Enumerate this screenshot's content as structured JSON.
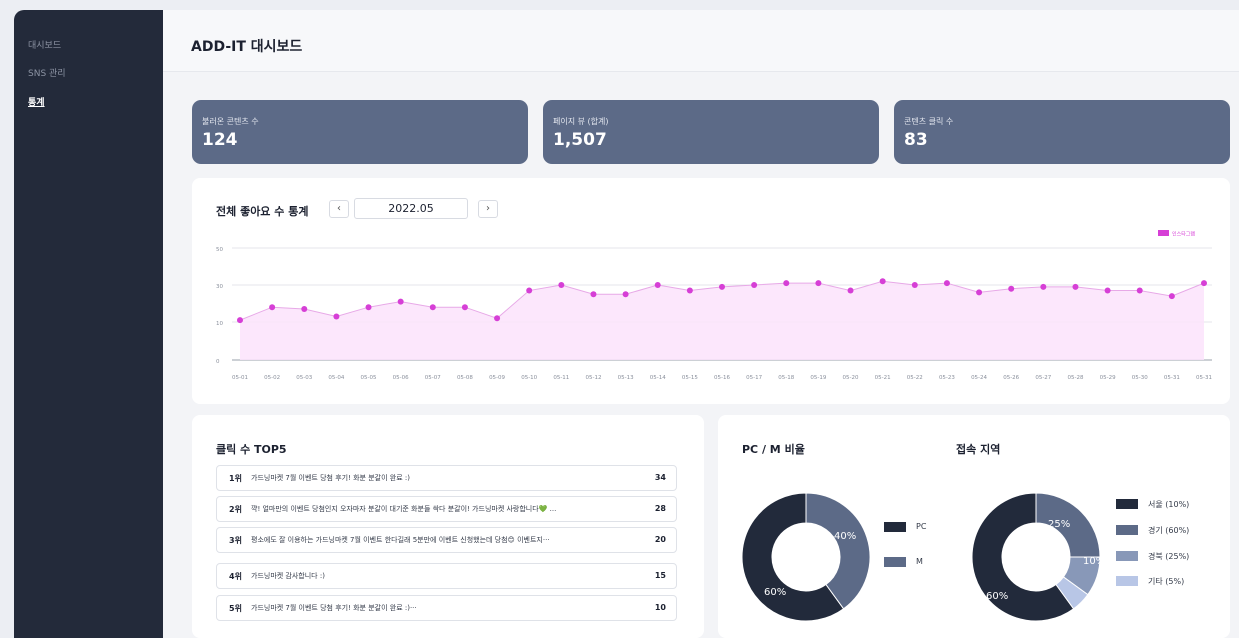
{
  "sidebar": {
    "items": [
      {
        "label": "대시보드",
        "active": false
      },
      {
        "label": "SNS 관리",
        "active": false
      },
      {
        "label": "통계",
        "active": true
      }
    ]
  },
  "header": {
    "title": "ADD-IT 대시보드"
  },
  "stats": [
    {
      "label": "불러온 콘텐츠 수",
      "value": "124"
    },
    {
      "label": "페이지 뷰 (합계)",
      "value": "1,507"
    },
    {
      "label": "콘텐츠 클릭 수",
      "value": "83"
    }
  ],
  "likes_chart": {
    "title": "전체 좋아요 수 통계",
    "prev_label": "‹",
    "next_label": "›",
    "month": "2022.05"
  },
  "chart_data": {
    "type": "area",
    "series": [
      {
        "name": "인스타그램",
        "color": "#d63fd6",
        "values": [
          11,
          18,
          17,
          13,
          18,
          21,
          18,
          18,
          12,
          27,
          30,
          25,
          25,
          30,
          27,
          29,
          30,
          31,
          31,
          27,
          32,
          30,
          31,
          26,
          28,
          29,
          29,
          27,
          27,
          24,
          31
        ]
      }
    ],
    "categories": [
      "05-01",
      "05-02",
      "05-03",
      "05-04",
      "05-05",
      "05-06",
      "05-07",
      "05-08",
      "05-09",
      "05-10",
      "05-11",
      "05-12",
      "05-13",
      "05-14",
      "05-15",
      "05-16",
      "05-17",
      "05-18",
      "05-19",
      "05-20",
      "05-21",
      "05-22",
      "05-23",
      "05-24",
      "05-26",
      "05-27",
      "05-28",
      "05-29",
      "05-30",
      "05-31",
      "05-31"
    ],
    "yticks": [
      "0",
      "10",
      "30",
      "50"
    ],
    "legend": "top-right"
  },
  "top5": {
    "title": "클릭 수 TOP5",
    "rows": [
      {
        "rank": "1위",
        "title": "가드닝마켓 7월 이벤트 당첨 후기! 화분 분갈이 완료 :)",
        "count": "34"
      },
      {
        "rank": "2위",
        "title": "꺅! 얼마만의 이벤트 당첨인지 오자마자 분갈이 대기준 화분들 싹다 분갈이! 가드닝마켓 사랑합니다💚 ...",
        "count": "28"
      },
      {
        "rank": "3위",
        "title": "평소에도 잘 이용하는 가드닝마켓 7월 이벤트 한다길래 5분만에 이벤트 신청했는데 당첨😊 이벤트지···",
        "count": "20"
      },
      {
        "rank": "4위",
        "title": "가드닝마켓 감사합니다 :)",
        "count": "15"
      },
      {
        "rank": "5위",
        "title": "가드닝마켓 7월 이벤트 당첨 후기! 화분 분갈이 완료 :)···",
        "count": "10"
      }
    ]
  },
  "pc_m": {
    "title": "PC / M 비율",
    "slices": [
      {
        "label": "PC",
        "value": 60,
        "color": "#222a3b"
      },
      {
        "label": "M",
        "value": 40,
        "color": "#5c6a87"
      }
    ],
    "slice_labels": [
      "60%",
      "40%"
    ]
  },
  "region": {
    "title": "접속 지역",
    "slices": [
      {
        "label": "서울 (10%)",
        "value": 60,
        "color": "#222a3b"
      },
      {
        "label": "경기 (60%)",
        "value": 25,
        "color": "#5c6a87"
      },
      {
        "label": "경북 (25%)",
        "value": 10,
        "color": "#8898b8"
      },
      {
        "label": "기타 (5%)",
        "value": 5,
        "color": "#b8c6e6"
      }
    ],
    "slice_labels": [
      "60%",
      "25%",
      "10%"
    ]
  }
}
